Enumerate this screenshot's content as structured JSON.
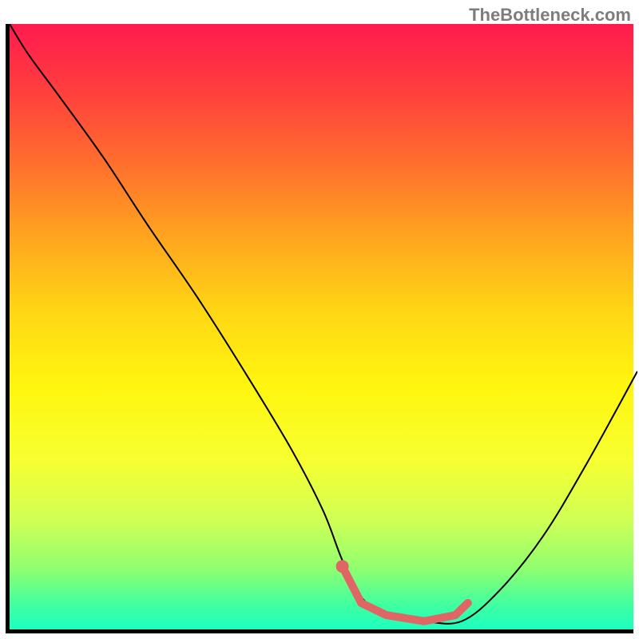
{
  "watermark": "TheBottleneck.com",
  "chart_data": {
    "type": "line",
    "title": "",
    "xlabel": "",
    "ylabel": "",
    "xlim": [
      0,
      100
    ],
    "ylim": [
      0,
      100
    ],
    "series": [
      {
        "name": "bottleneck-curve",
        "x": [
          0,
          3,
          8,
          15,
          22,
          30,
          38,
          45,
          50,
          53,
          56,
          60,
          66,
          72,
          78,
          85,
          92,
          100
        ],
        "y": [
          100,
          95,
          88,
          78,
          67,
          55,
          42,
          30,
          20,
          12,
          6,
          3,
          2,
          2,
          7,
          16,
          28,
          43
        ],
        "color": "#000000",
        "stroke_width": 2
      },
      {
        "name": "highlight-segment",
        "x": [
          53,
          56,
          60,
          66,
          71,
          73
        ],
        "y": [
          11,
          5,
          3,
          2,
          3,
          5
        ],
        "color": "#e06666",
        "stroke_width": 10
      }
    ],
    "markers": [
      {
        "name": "highlight-dot",
        "x": 53,
        "y": 11,
        "color": "#e06666",
        "r": 8
      }
    ]
  }
}
